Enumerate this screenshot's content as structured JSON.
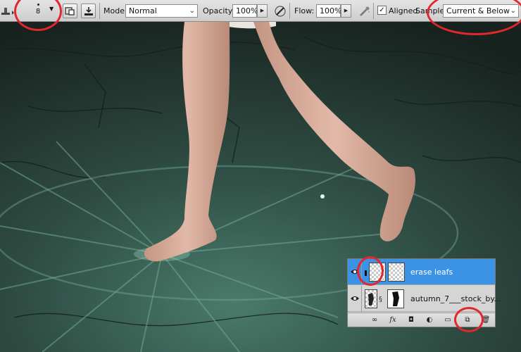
{
  "toolbar": {
    "brush_size": "8",
    "mode_label": "Mode:",
    "mode_value": "Normal",
    "opacity_label": "Opacity:",
    "opacity_value": "100%",
    "flow_label": "Flow:",
    "flow_value": "100%",
    "aligned_label": "Aligned",
    "aligned_checked": "✓",
    "sample_label": "Sample:",
    "sample_value": "Current & Below"
  },
  "layers": {
    "items": [
      {
        "name": "erase leafs",
        "selected": true
      },
      {
        "name": "autumn_7___stock_by...",
        "selected": false
      }
    ],
    "footer_icons": [
      "link-icon",
      "fx-icon",
      "mask-icon",
      "adjustment-icon",
      "group-icon",
      "new-layer-icon",
      "trash-icon"
    ]
  },
  "colors": {
    "selection": "#3c93e6",
    "annotation": "#e3262b",
    "canvas_ground": "#34524a"
  }
}
